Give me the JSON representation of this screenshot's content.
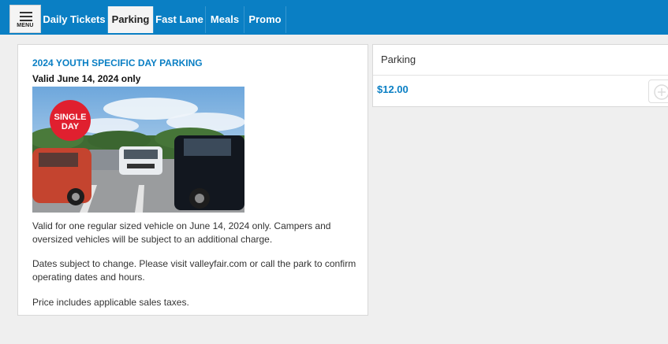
{
  "menu": {
    "label": "MENU",
    "icon": "hamburger-icon"
  },
  "tabs": [
    {
      "label": "Daily Tickets",
      "active": false
    },
    {
      "label": "Parking",
      "active": true
    },
    {
      "label": "Fast Lane",
      "active": false
    },
    {
      "label": "Meals",
      "active": false
    },
    {
      "label": "Promo",
      "active": false
    }
  ],
  "product": {
    "title": "2024 YOUTH SPECIFIC DAY PARKING",
    "valid": "Valid June 14, 2024 only",
    "badge_line1": "SINGLE",
    "badge_line2": "DAY",
    "paragraphs": [
      "Valid for one regular sized vehicle on June 14, 2024 only. Campers and oversized vehicles will be subject to an additional charge.",
      "Dates subject to change. Please visit valleyfair.com or call the park to confirm operating dates and hours.",
      "Price includes applicable sales taxes."
    ]
  },
  "purchase": {
    "header": "Parking",
    "price": "$12.00",
    "add_icon": "plus-circle-icon"
  },
  "colors": {
    "brand_blue": "#0a7fc4",
    "badge_red": "#e0202f"
  }
}
